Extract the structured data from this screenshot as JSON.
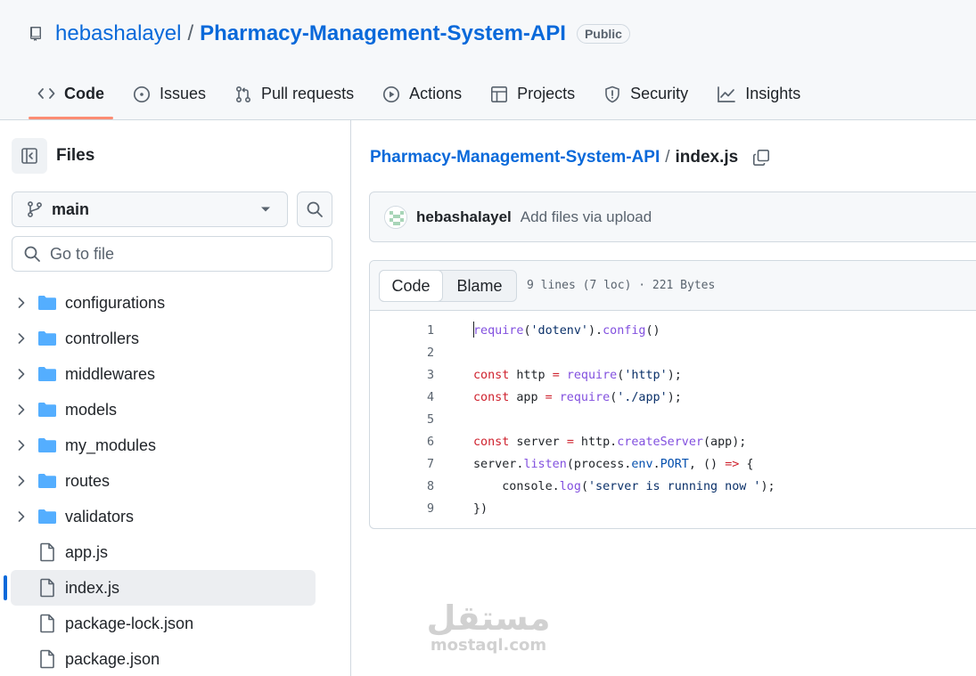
{
  "header": {
    "owner": "hebashalayel",
    "separator": "/",
    "repo": "Pharmacy-Management-System-API",
    "visibility": "Public",
    "tabs": [
      {
        "label": "Code",
        "icon": "code-icon",
        "active": true
      },
      {
        "label": "Issues",
        "icon": "issue-opened-icon",
        "active": false
      },
      {
        "label": "Pull requests",
        "icon": "git-pull-request-icon",
        "active": false
      },
      {
        "label": "Actions",
        "icon": "play-icon",
        "active": false
      },
      {
        "label": "Projects",
        "icon": "table-icon",
        "active": false
      },
      {
        "label": "Security",
        "icon": "shield-icon",
        "active": false
      },
      {
        "label": "Insights",
        "icon": "graph-icon",
        "active": false
      }
    ]
  },
  "sidebar": {
    "title": "Files",
    "branch": "main",
    "search_placeholder": "Go to file",
    "items": [
      {
        "name": "configurations",
        "type": "folder"
      },
      {
        "name": "controllers",
        "type": "folder"
      },
      {
        "name": "middlewares",
        "type": "folder"
      },
      {
        "name": "models",
        "type": "folder"
      },
      {
        "name": "my_modules",
        "type": "folder"
      },
      {
        "name": "routes",
        "type": "folder"
      },
      {
        "name": "validators",
        "type": "folder"
      },
      {
        "name": "app.js",
        "type": "file"
      },
      {
        "name": "index.js",
        "type": "file",
        "selected": true
      },
      {
        "name": "package-lock.json",
        "type": "file"
      },
      {
        "name": "package.json",
        "type": "file"
      }
    ]
  },
  "main": {
    "breadcrumb_repo": "Pharmacy-Management-System-API",
    "breadcrumb_sep": "/",
    "breadcrumb_file": "index.js",
    "commit": {
      "author": "hebashalayel",
      "message": "Add files via upload"
    },
    "viewer": {
      "code_tab": "Code",
      "blame_tab": "Blame",
      "file_info": "9 lines (7 loc) · 221 Bytes"
    },
    "code_lines": [
      "require('dotenv').config()",
      "",
      "const http = require('http');",
      "const app = require('./app');",
      "",
      "const server = http.createServer(app);",
      "server.listen(process.env.PORT, () => {",
      "    console.log('server is running now ');",
      "})"
    ]
  },
  "watermark": {
    "arabic": "مستقل",
    "latin": "mostaql.com"
  },
  "colors": {
    "link": "#0969da",
    "active_tab_underline": "#fd8c73",
    "folder": "#54aeff",
    "keyword": "#cf222e",
    "function": "#8250df",
    "string": "#0a3069",
    "constant": "#0550ae"
  }
}
